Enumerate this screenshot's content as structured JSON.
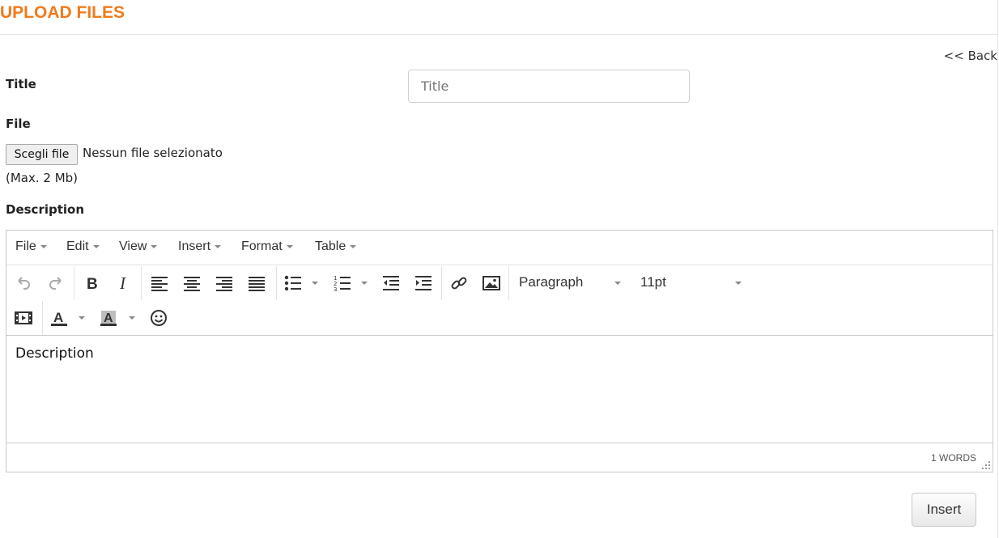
{
  "page": {
    "title": "UPLOAD FILES",
    "back_label": "<< Back"
  },
  "form": {
    "title_label": "Title",
    "title_placeholder": "Title",
    "title_value": "",
    "file_label": "File",
    "file_button_label": "Scegli file",
    "file_status": "Nessun file selezionato",
    "max_size_note": "(Max. 2 Mb)",
    "description_label": "Description",
    "submit_label": "Insert"
  },
  "editor": {
    "menus": [
      "File",
      "Edit",
      "View",
      "Insert",
      "Format",
      "Table"
    ],
    "toolbar": {
      "icons": [
        "undo-icon",
        "redo-icon",
        "bold-icon",
        "italic-icon",
        "align-left-icon",
        "align-center-icon",
        "align-right-icon",
        "align-justify-icon",
        "bullet-list-icon",
        "numbered-list-icon",
        "outdent-icon",
        "indent-icon",
        "link-icon",
        "image-icon",
        "media-icon",
        "text-color-icon",
        "background-color-icon",
        "emoticons-icon"
      ],
      "block_format": "Paragraph",
      "font_size": "11pt"
    },
    "content": "Description",
    "word_count": "1 WORDS"
  },
  "colors": {
    "accent": "#f07b1c",
    "border": "#c9c9c9",
    "text": "#333333"
  }
}
